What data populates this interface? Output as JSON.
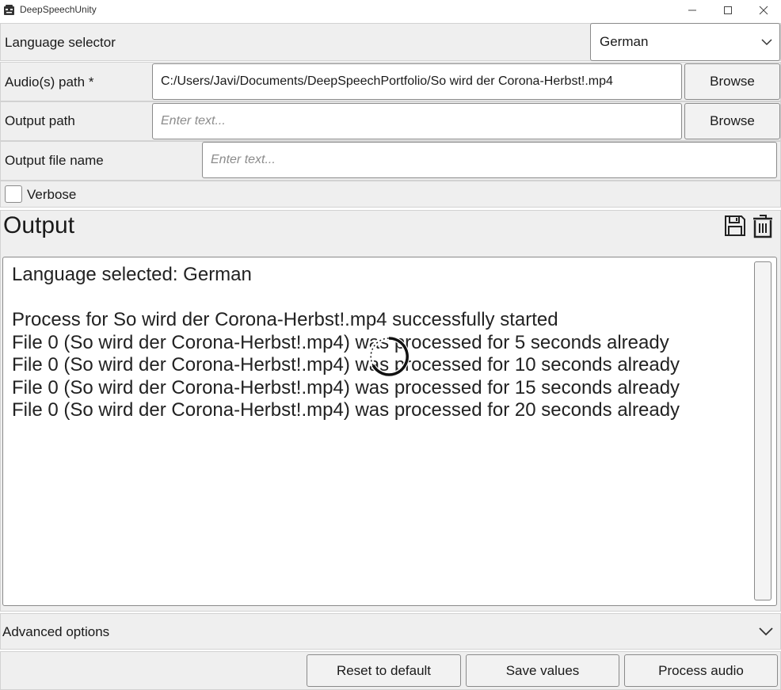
{
  "window": {
    "title": "DeepSpeechUnity",
    "controls": {
      "minimize": "minimize-icon",
      "maximize": "maximize-icon",
      "close": "close-icon"
    }
  },
  "language": {
    "label": "Language selector",
    "selected": "German"
  },
  "audio_path": {
    "label": "Audio(s) path *",
    "value": "C:/Users/Javi/Documents/DeepSpeechPortfolio/So wird der Corona-Herbst!.mp4",
    "browse_label": "Browse"
  },
  "output_path": {
    "label": "Output path",
    "placeholder": "Enter text...",
    "browse_label": "Browse"
  },
  "output_file_name": {
    "label": "Output file name",
    "placeholder": "Enter text..."
  },
  "verbose": {
    "label": "Verbose",
    "checked": false
  },
  "output": {
    "title": "Output",
    "save_icon": "floppy-disk-icon",
    "delete_icon": "trash-icon",
    "lines": [
      "Language selected: German",
      "",
      "Process for So wird der Corona-Herbst!.mp4 successfully started",
      "File 0 (So wird der Corona-Herbst!.mp4) was processed for 5 seconds already",
      "File 0 (So wird der Corona-Herbst!.mp4) was processed for 10 seconds already",
      "File 0 (So wird der Corona-Herbst!.mp4) was processed for 15 seconds already",
      "File 0 (So wird der Corona-Herbst!.mp4) was processed for 20 seconds already"
    ]
  },
  "advanced": {
    "label": "Advanced options"
  },
  "footer": {
    "reset_label": "Reset to default",
    "save_label": "Save values",
    "process_label": "Process audio"
  }
}
